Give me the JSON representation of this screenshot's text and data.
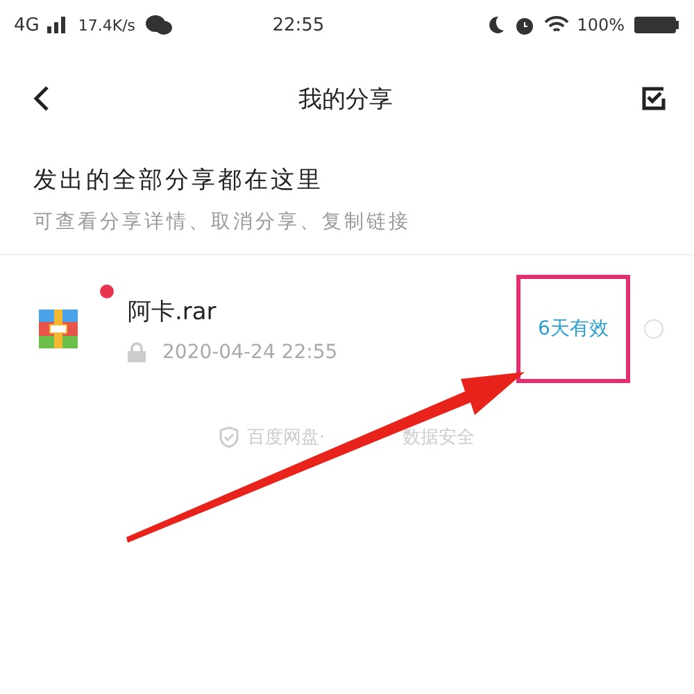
{
  "status_bar": {
    "network": "4G",
    "speed": "17.4K/s",
    "time": "22:55",
    "battery": "100%"
  },
  "header": {
    "title": "我的分享"
  },
  "intro": {
    "headline": "发出的全部分享都在这里",
    "subtitle": "可查看分享详情、取消分享、复制链接"
  },
  "shares": [
    {
      "name": "阿卡.rar",
      "date": "2020-04-24 22:55",
      "validity": "6天有效",
      "unread": true,
      "locked": true,
      "selected": false
    }
  ],
  "footer": {
    "parts": [
      "百度网盘·",
      "数据安全"
    ]
  }
}
